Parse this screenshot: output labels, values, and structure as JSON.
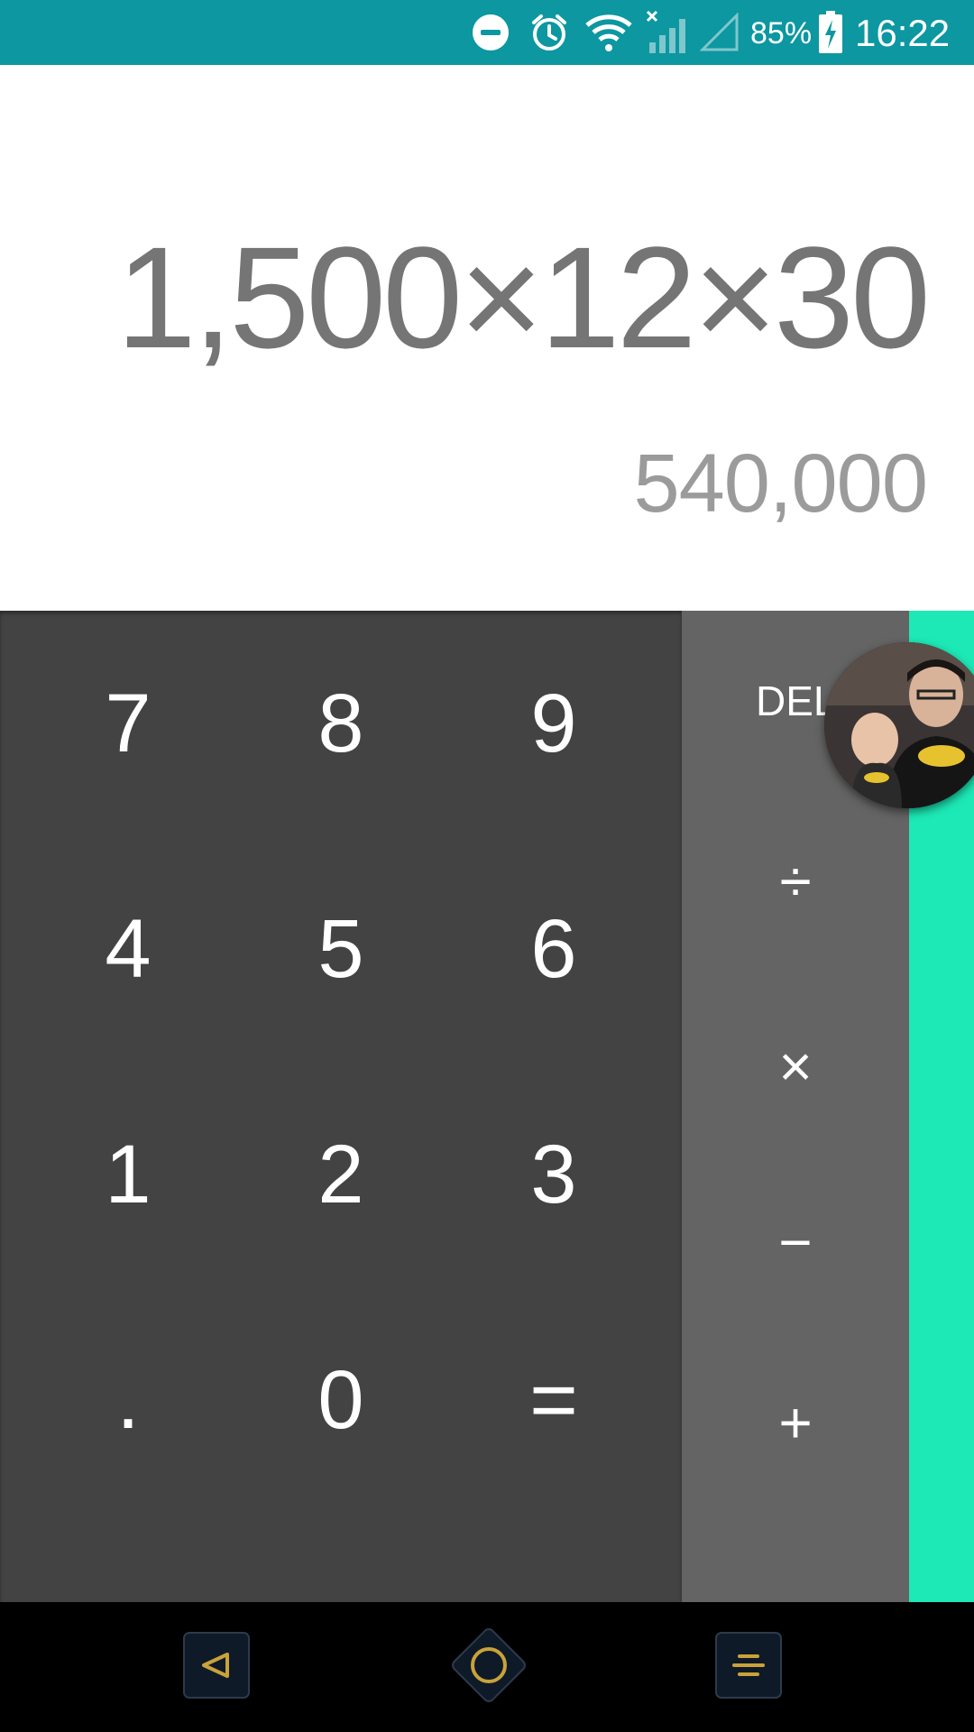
{
  "status_bar": {
    "icons": [
      "do-not-disturb-icon",
      "alarm-icon",
      "wifi-icon",
      "no-signal-icon",
      "signal-empty-icon",
      "battery-charging-icon"
    ],
    "battery": "85%",
    "time": "16:22",
    "color": "#0c97a1"
  },
  "display": {
    "formula": "1,500×12×30",
    "result": "540,000"
  },
  "keypad": {
    "digits": {
      "k7": "7",
      "k8": "8",
      "k9": "9",
      "k4": "4",
      "k5": "5",
      "k6": "6",
      "k1": "1",
      "k2": "2",
      "k3": "3",
      "dot": ".",
      "k0": "0",
      "eq": "="
    },
    "operators": {
      "del": "DEL",
      "divide": "÷",
      "multiply": "×",
      "minus": "−",
      "plus": "+"
    },
    "colors": {
      "numpad": "#434343",
      "oppad": "#646464",
      "advanced": "#1de9b6"
    }
  },
  "floating_avatar": {
    "icon": "chat-head-avatar"
  },
  "nav_bar": {
    "icons": [
      "back-icon",
      "home-icon",
      "recents-icon"
    ],
    "accent": "#c9a23a"
  }
}
